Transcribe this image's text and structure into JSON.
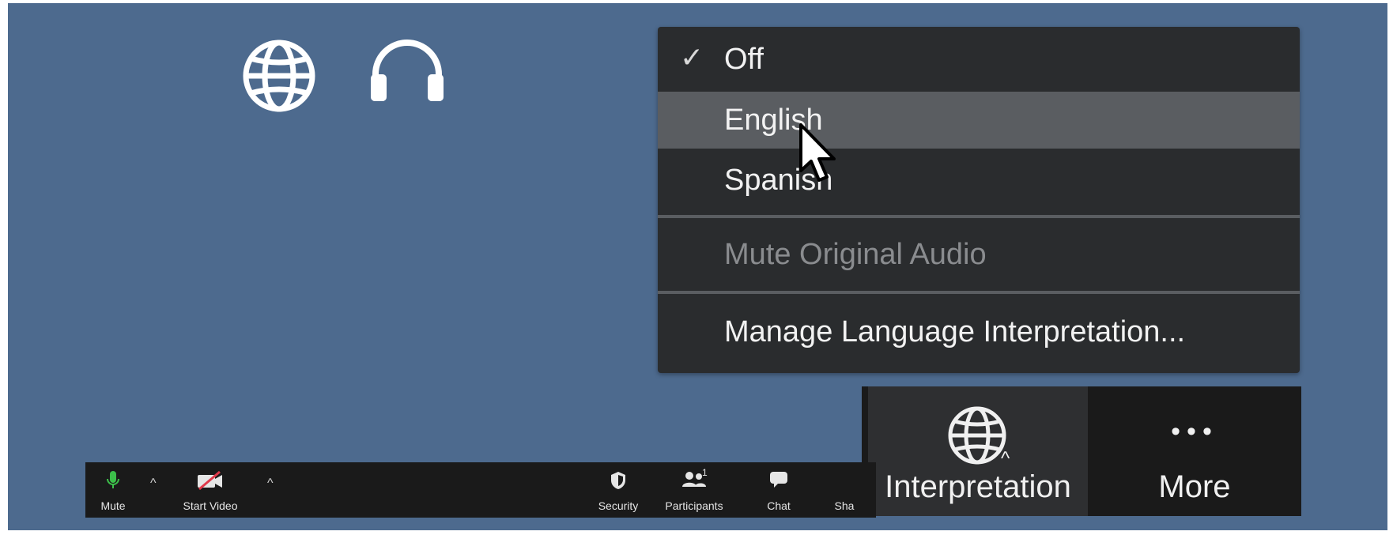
{
  "menu": {
    "check_mark": "✓",
    "items": [
      "Off",
      "English",
      "Spanish"
    ],
    "mute_original_audio": "Mute Original Audio",
    "manage": "Manage Language Interpretation..."
  },
  "toolbar_large": {
    "interpretation_label": "Interpretation",
    "more_label": "More",
    "more_dots": "•••",
    "caret": "^"
  },
  "toolbar_small": {
    "mute_label": "Mute",
    "start_video_label": "Start Video",
    "security_label": "Security",
    "participants_label": "Participants",
    "participants_count": "1",
    "chat_label": "Chat",
    "share_label": "Sha",
    "caret": "^"
  },
  "icons": {
    "top_left": [
      "globe-icon",
      "headphones-icon"
    ],
    "cursor": "mouse-pointer-icon"
  },
  "colors": {
    "background": "#4d6a8e",
    "menu_bg": "#2a2c2e",
    "menu_hover": "#5a5d61",
    "toolbar_bg": "#1a1a1a",
    "mic_green": "#3cbf4a",
    "video_off_red": "#e0394a"
  }
}
